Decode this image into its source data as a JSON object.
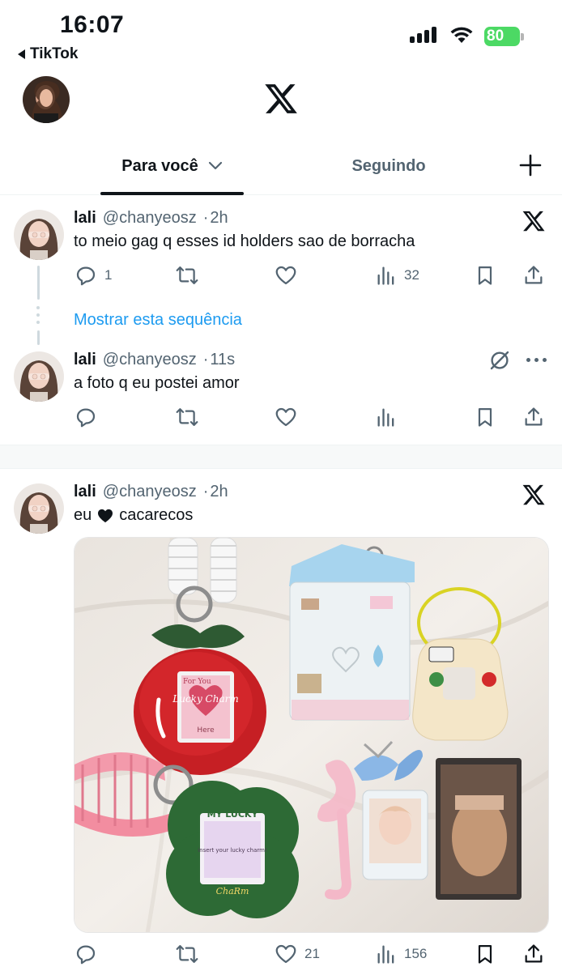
{
  "status_bar": {
    "time": "16:07",
    "back_app": "TikTok",
    "battery": "80"
  },
  "header": {
    "logo": "x-logo-icon"
  },
  "tabs": [
    {
      "label": "Para você",
      "active": true
    },
    {
      "label": "Seguindo",
      "active": false
    }
  ],
  "colors": {
    "accent": "#1d9bf0",
    "text_primary": "#0f1419",
    "text_secondary": "#536471",
    "battery_green": "#4cd964"
  },
  "tweets": [
    {
      "name": "lali",
      "handle": "@chanyeosz",
      "sep": "·",
      "time": "2h",
      "text": "to meio gag q esses id holders sao de borracha",
      "replies": "1",
      "retweets": "",
      "likes": "",
      "views": "32"
    },
    {
      "name": "lali",
      "handle": "@chanyeosz",
      "sep": "·",
      "time": "11s",
      "text": "a foto q eu postei amor",
      "replies": "",
      "retweets": "",
      "likes": "",
      "views": ""
    },
    {
      "name": "lali",
      "handle": "@chanyeosz",
      "sep": "·",
      "time": "2h",
      "text_before": "eu",
      "text_after": "cacarecos",
      "replies": "",
      "retweets": "",
      "likes": "21",
      "views": "156"
    }
  ],
  "thread": {
    "show_label": "Mostrar esta sequência"
  },
  "media_stickers": {
    "charm1_top": "For You",
    "charm1_mid": "Lucky Charm",
    "charm1_bottom": "Here",
    "charm2_top": "MY LUCKY",
    "charm2_mid": "insert your lucky charm!",
    "charm2_bottom": "ChaRm"
  }
}
